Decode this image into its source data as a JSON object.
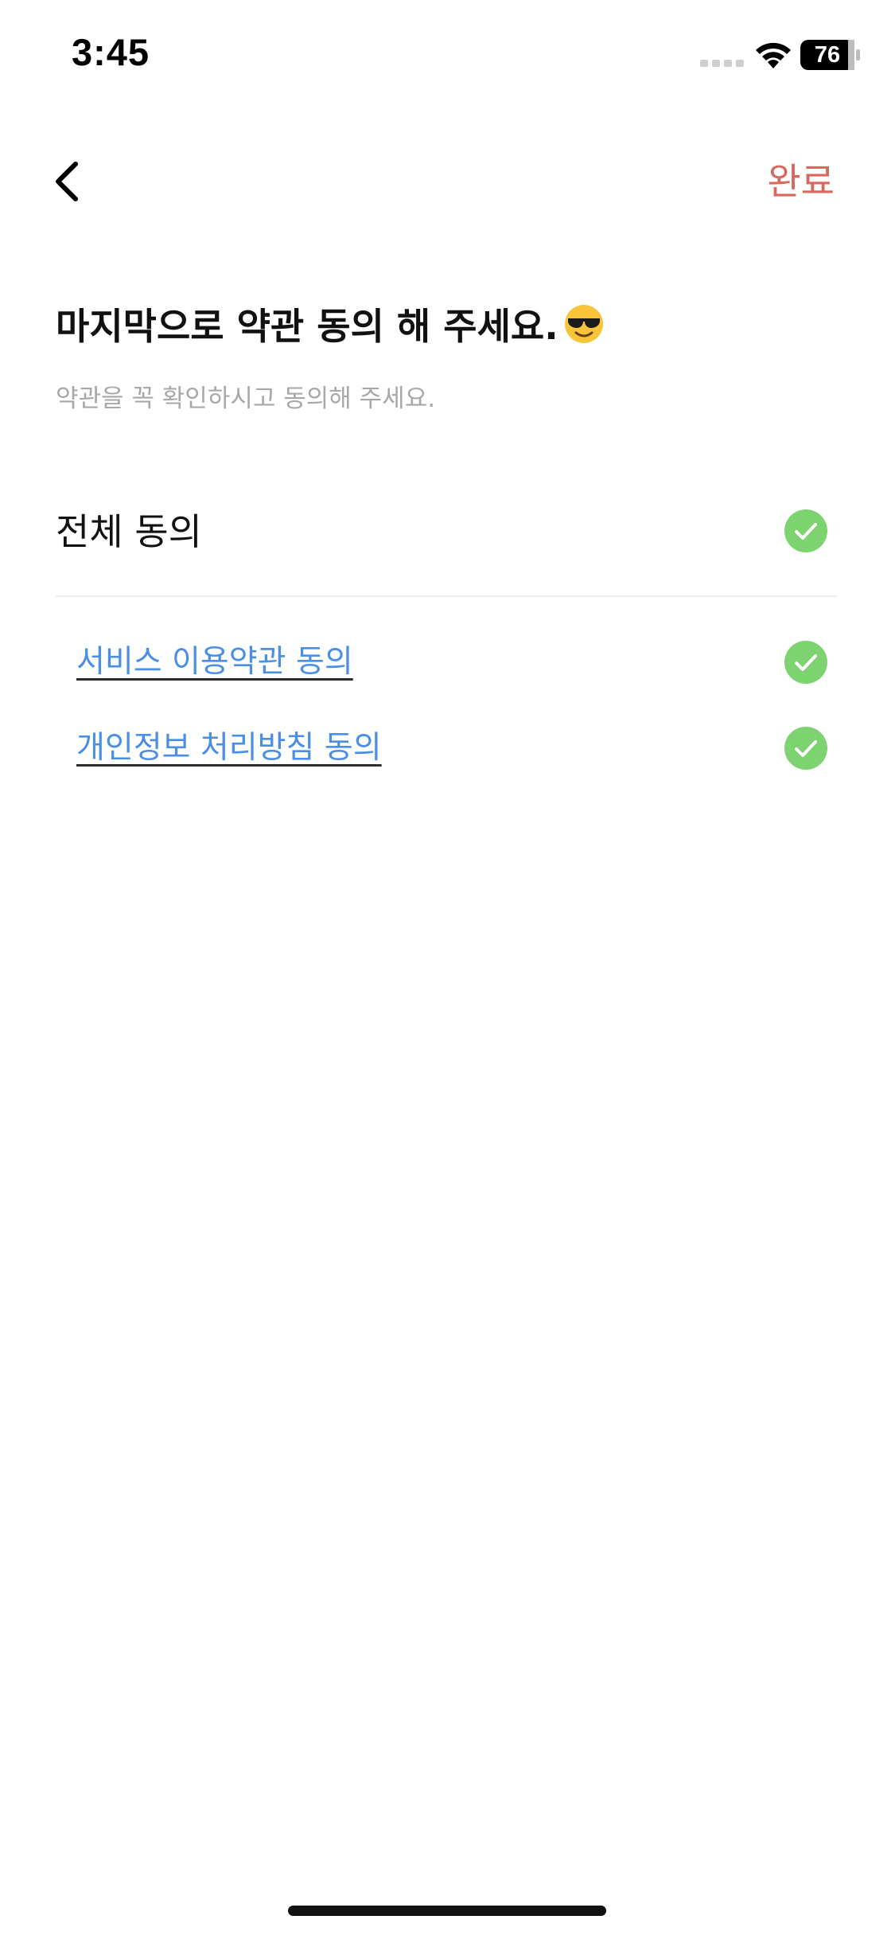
{
  "status_bar": {
    "time": "3:45",
    "battery_percent": "76",
    "signal_icon": "cellular-signal-icon",
    "wifi_icon": "wifi-icon",
    "battery_icon": "battery-icon"
  },
  "header": {
    "back_icon": "chevron-left-icon",
    "done_label": "완료"
  },
  "intro": {
    "title": "마지막으로 약관 동의 해 주세요.",
    "title_emoji": "smiling-face-with-sunglasses-icon",
    "subtitle": "약관을 꼭 확인하시고 동의해 주세요."
  },
  "agree_all": {
    "label": "전체 동의",
    "checked": true
  },
  "terms": [
    {
      "label": "서비스 이용약관 동의",
      "checked": true
    },
    {
      "label": "개인정보 처리방침 동의",
      "checked": true
    }
  ],
  "colors": {
    "accent": "#d9675d",
    "link": "#4a8ee6",
    "check": "#7dd36f",
    "subtitle": "#a8a8a8"
  }
}
